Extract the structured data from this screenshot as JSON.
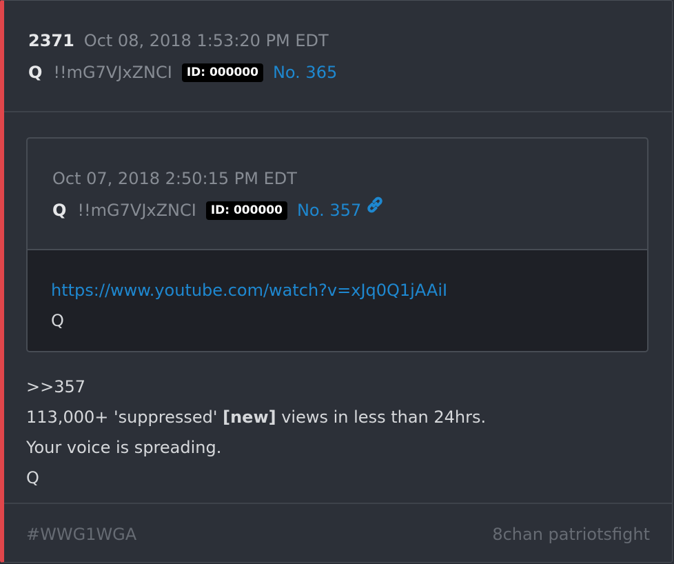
{
  "post": {
    "number": "2371",
    "date": "Oct 08, 2018 1:53:20 PM EDT",
    "author": "Q",
    "tripcode": "!!mG7VJxZNCI",
    "id_label": "ID: 000000",
    "post_link": "No. 365"
  },
  "quoted": {
    "date": "Oct 07, 2018 2:50:15 PM EDT",
    "author": "Q",
    "tripcode": "!!mG7VJxZNCI",
    "id_label": "ID: 000000",
    "post_link": "No. 357",
    "link_icon": "link-icon",
    "url": "https://www.youtube.com/watch?v=xJq0Q1jAAiI",
    "signature": "Q"
  },
  "body": {
    "reply_ref": ">>357",
    "line2_prefix": "113,000+ 'suppressed' ",
    "line2_bold": "[new]",
    "line2_suffix": " views in less than 24hrs.",
    "line3": "Your voice is spreading.",
    "signature": "Q"
  },
  "footer": {
    "hashtag": "#WWG1WGA",
    "source": "8chan patriotsfight"
  },
  "colors": {
    "accent_border": "#e0464b",
    "link": "#1e88d0",
    "card_bg": "#2c3038",
    "quote_body_bg": "#1e2026"
  }
}
